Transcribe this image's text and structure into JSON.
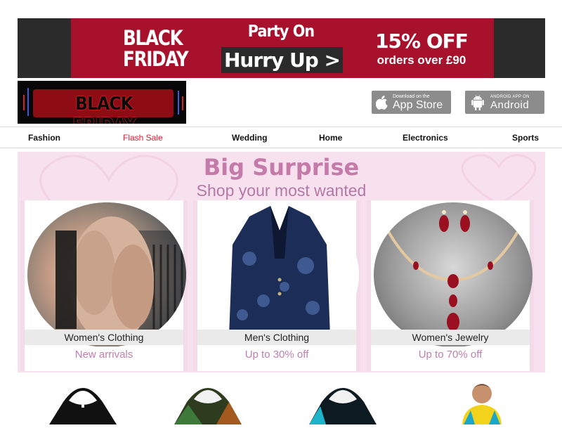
{
  "promo": {
    "black_friday_line1": "BLACK",
    "black_friday_line2": "FRIDAY",
    "party_on": "Party On",
    "hurry_up": "Hurry Up >",
    "discount": "15% OFF",
    "orders": "orders over £90"
  },
  "logo": {
    "text": "BLACK FRIDAY"
  },
  "apps": {
    "ios_small": "Download on the",
    "ios_big": "App Store",
    "android_small": "ANDROID APP ON",
    "android_big": "Android"
  },
  "nav": {
    "items": [
      "Fashion",
      "Flash Sale",
      "Wedding",
      "Home",
      "Electronics",
      "Sports"
    ]
  },
  "surprise": {
    "title": "Big Surprise",
    "subtitle": "Shop your most wanted",
    "cards": [
      {
        "caption": "Women's Clothing",
        "sub": "New arrivals"
      },
      {
        "caption": "Men's Clothing",
        "sub": "Up to 30% off"
      },
      {
        "caption": "Women's Jewelry",
        "sub": "Up to 70% off"
      }
    ]
  },
  "colors": {
    "promo_red": "#a8112c",
    "flash_sale_red": "#e21b2b",
    "surprise_pink": "#f8e1ee",
    "title_pink": "#c47ba9"
  }
}
